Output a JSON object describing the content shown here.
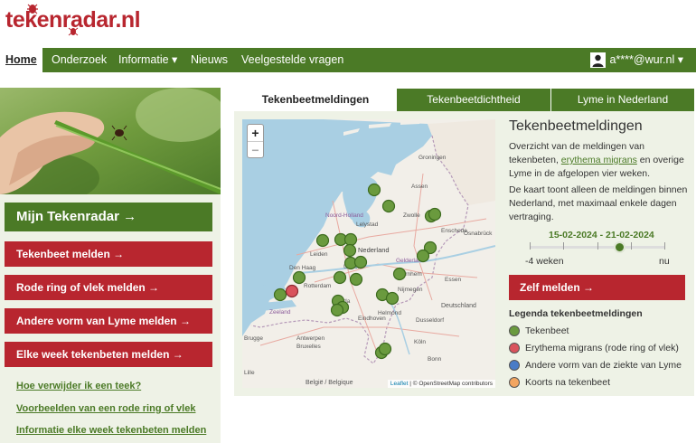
{
  "site": {
    "logo_text": "tekenradar.nl"
  },
  "nav": {
    "items": [
      {
        "label": "Home",
        "active": true
      },
      {
        "label": "Onderzoek"
      },
      {
        "label": "Informatie ▾"
      },
      {
        "label": "Nieuws"
      },
      {
        "label": "Veelgestelde vragen"
      }
    ],
    "user": "a****@wur.nl ▾"
  },
  "sidebar": {
    "mijn_label": "Mijn Tekenradar →",
    "buttons": [
      {
        "label": "Tekenbeet melden →"
      },
      {
        "label": "Rode ring of vlek melden →"
      },
      {
        "label": "Andere vorm van Lyme melden →"
      },
      {
        "label": "Elke week tekenbeten melden →"
      }
    ],
    "links": [
      {
        "label": "Hoe verwijder ik een teek?"
      },
      {
        "label": "Voorbeelden van een rode ring of vlek"
      },
      {
        "label": "Informatie elke week tekenbeten melden"
      }
    ]
  },
  "tabs": [
    {
      "label": "Tekenbeetmeldingen",
      "active": true
    },
    {
      "label": "Tekenbeetdichtheid"
    },
    {
      "label": "Lyme in Nederland"
    }
  ],
  "map": {
    "zoom_in": "+",
    "zoom_out": "−",
    "attribution_leaflet": "Leaflet",
    "attribution_osm": "| © OpenStreetMap contributors",
    "place_labels": [
      {
        "name": "Assen"
      },
      {
        "name": "Noord-Holland"
      },
      {
        "name": "Lelystad"
      },
      {
        "name": "Nederland"
      },
      {
        "name": "Leiden"
      },
      {
        "name": "Den Haag"
      },
      {
        "name": "Rotterdam"
      },
      {
        "name": "Arnhem"
      },
      {
        "name": "Nijmegen"
      },
      {
        "name": "Zeeland"
      },
      {
        "name": "Antwerpen"
      },
      {
        "name": "Bruxelles"
      },
      {
        "name": "Helmond"
      },
      {
        "name": "Essen"
      },
      {
        "name": "Dusseldorf"
      },
      {
        "name": "Köln"
      },
      {
        "name": "Bonn"
      },
      {
        "name": "Lille"
      },
      {
        "name": "Brugge"
      },
      {
        "name": "België / Belgique"
      },
      {
        "name": "Deutschland"
      },
      {
        "name": "Osnabrück"
      },
      {
        "name": "Enschede"
      },
      {
        "name": "Zwolle"
      },
      {
        "name": "Gelderland"
      },
      {
        "name": "Utrecht"
      },
      {
        "name": "Eindhoven"
      },
      {
        "name": "Breda"
      },
      {
        "name": "Groningen"
      }
    ]
  },
  "info": {
    "title": "Tekenbeetmeldingen",
    "p1_a": "Overzicht van de meldingen van tekenbeten, ",
    "p1_link": "erythema migrans",
    "p1_b": " en overige Lyme in de afgelopen vier weken.",
    "p2": "De kaart toont alleen de meldingen binnen Nederland, met maximaal enkele dagen vertraging.",
    "range": "15-02-2024 - 21-02-2024",
    "slider_left": "-4 weken",
    "slider_right": "nu",
    "slider_position": 0.75,
    "zelf_label": "Zelf melden →",
    "legend_title": "Legenda tekenbeetmeldingen",
    "legend": [
      {
        "label": "Tekenbeet",
        "color": "#6a9a3e"
      },
      {
        "label": "Erythema migrans (rode ring of vlek)",
        "color": "#d9535c"
      },
      {
        "label": "Andere vorm van de ziekte van Lyme",
        "color": "#4a7cc7"
      },
      {
        "label": "Koorts na tekenbeet",
        "color": "#f2a560"
      }
    ]
  },
  "colors": {
    "brand_green": "#4b7a26",
    "brand_red": "#b8262f"
  }
}
